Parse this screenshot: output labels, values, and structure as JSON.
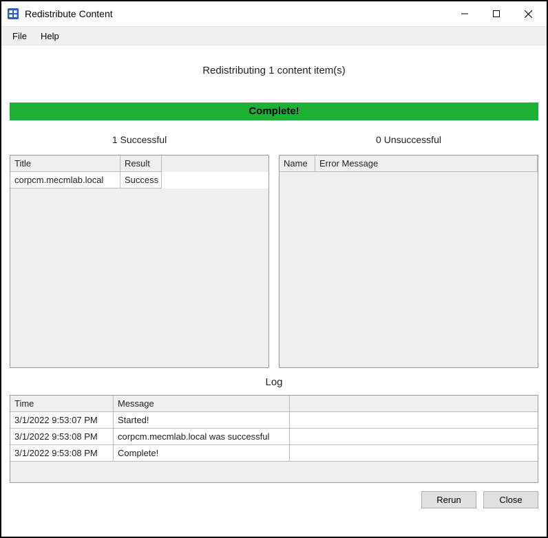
{
  "window": {
    "title": "Redistribute Content"
  },
  "menu": {
    "file": "File",
    "help": "Help"
  },
  "heading": "Redistributing 1 content item(s)",
  "banner": {
    "text": "Complete!",
    "color": "#1db034"
  },
  "successful": {
    "label": "1 Successful",
    "columns": {
      "title": "Title",
      "result": "Result"
    },
    "rows": [
      {
        "title": "corpcm.mecmlab.local",
        "result": "Success"
      }
    ]
  },
  "unsuccessful": {
    "label": "0 Unsuccessful",
    "columns": {
      "name": "Name",
      "error": "Error Message"
    },
    "rows": []
  },
  "log": {
    "label": "Log",
    "columns": {
      "time": "Time",
      "message": "Message"
    },
    "rows": [
      {
        "time": "3/1/2022 9:53:07 PM",
        "message": "Started!"
      },
      {
        "time": "3/1/2022 9:53:08 PM",
        "message": "corpcm.mecmlab.local was successful"
      },
      {
        "time": "3/1/2022 9:53:08 PM",
        "message": "Complete!"
      }
    ]
  },
  "buttons": {
    "rerun": "Rerun",
    "close": "Close"
  }
}
